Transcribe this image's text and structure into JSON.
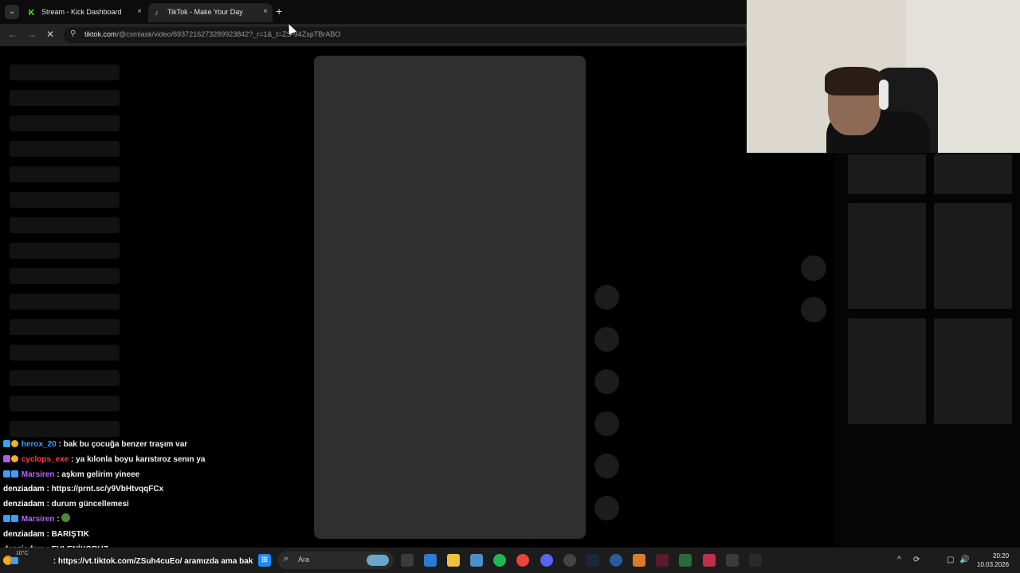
{
  "browser": {
    "tabs": [
      {
        "label": "Stream - Kick Dashboard",
        "favicon": "kick-icon"
      },
      {
        "label": "TikTok - Make Your Day",
        "favicon": "tiktok-icon"
      }
    ],
    "close_glyph": "×",
    "new_tab_glyph": "+",
    "tab_menu_glyph": "⌄",
    "url_host": "tiktok.com",
    "url_path": "/@csmlask/video/6937216273289923842?_r=1&_t=ZS-94ZspTBrABO",
    "back_glyph": "←",
    "forward_glyph": "→",
    "stop_glyph": "✕",
    "tune_glyph": "⚲"
  },
  "chat": {
    "messages": [
      {
        "user": "herox_20",
        "user_color": "#3aa0ff",
        "text": " : bak bu çocuğa benzer traşım var",
        "badges": [
          "#37a3e6",
          "#f2b01e"
        ]
      },
      {
        "user": "cyclops_exe",
        "user_color": "#ff3c3c",
        "text": " : ya kılonla boyu karıstıroz senın ya",
        "badges": [
          "#b060e0",
          "#f2b01e"
        ]
      },
      {
        "user": "Marsiren",
        "user_color": "#b366ff",
        "text": " : aşkım gelirim yineee",
        "badges": [
          "#3aa0ff",
          "#3aa0ff"
        ]
      },
      {
        "user": "denziadam",
        "user_color": "#ffffff",
        "text": " : https://prnt.sc/y9VbHtvqqFCx",
        "badges": []
      },
      {
        "user": "denziadam",
        "user_color": "#ffffff",
        "text": " : durum güncellemesi",
        "badges": []
      },
      {
        "user": "Marsiren",
        "user_color": "#b366ff",
        "text": " : ",
        "badges": [
          "#3aa0ff",
          "#3aa0ff"
        ]
      },
      {
        "user": "denziadam",
        "user_color": "#ffffff",
        "text": " : BARIŞTIK",
        "badges": []
      },
      {
        "user": "denziadam",
        "user_color": "#ffffff",
        "text": " : EVLENİYORUZ",
        "badges": []
      }
    ],
    "last_line": ": https://vt.tiktok.com/ZSuh4cuEo/ aramızda ama bak"
  },
  "taskbar": {
    "search_placeholder": "Ara",
    "search_glyph": "⌕",
    "weather": "10°C",
    "time": "20:20",
    "date": "10.03.2026",
    "tray_glyphs": [
      "^",
      "⟳",
      "▢",
      "🔊"
    ]
  },
  "colors": {
    "video_placeholder": "#2f2f2f",
    "skeleton": "#121212",
    "taskbar": "#1c1c1c"
  }
}
